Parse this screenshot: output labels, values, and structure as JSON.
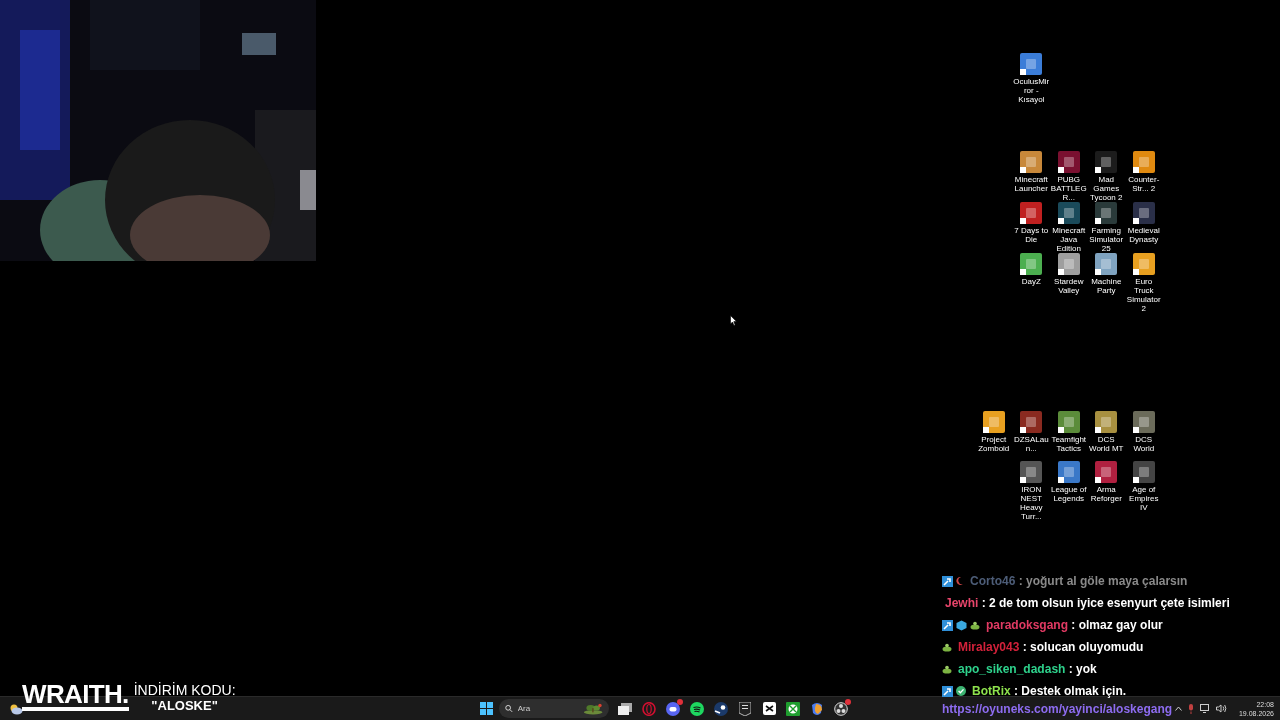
{
  "desktop_groups": [
    [
      [
        {
          "label": "OculusMirror - Kısayol"
        }
      ]
    ],
    [
      [
        {
          "label": "Minecraft Launcher"
        },
        {
          "label": "PUBG BATTLEGR..."
        },
        {
          "label": "Mad Games Tycoon 2"
        },
        {
          "label": "Counter-Str... 2"
        }
      ],
      [
        {
          "label": "7 Days to Die"
        },
        {
          "label": "Minecraft Java Edition"
        },
        {
          "label": "Farming Simulator 25"
        },
        {
          "label": "Medieval Dynasty"
        }
      ],
      [
        {
          "label": "DayZ"
        },
        {
          "label": "Stardew Valley"
        },
        {
          "label": "Machine Party"
        },
        {
          "label": "Euro Truck Simulator 2"
        }
      ]
    ],
    [
      [
        {
          "label": "Project Zomboid"
        },
        {
          "label": "DZSALaun..."
        },
        {
          "label": "Teamfight Tactics"
        },
        {
          "label": "DCS World MT"
        },
        {
          "label": "DCS World"
        }
      ],
      [
        {
          "label": "IRON NEST Heavy Turr..."
        },
        {
          "label": "League of Legends"
        },
        {
          "label": "Arma Reforger"
        },
        {
          "label": "Age of Empires IV"
        }
      ]
    ]
  ],
  "chat": [
    {
      "badges": [
        {
          "kind": "moderator"
        },
        {
          "kind": "moon"
        }
      ],
      "user": "Corto46",
      "color": "#4d5d78",
      "message": ": yoğurt al göle maya çalarsın",
      "faded": true
    },
    {
      "user": "Jewhi",
      "color": "#e8456b",
      "message": ": 2 de tom olsun iyice esenyurt çete isimleri",
      "faded": false
    },
    {
      "badges": [
        {
          "kind": "moderator"
        },
        {
          "kind": "cube"
        },
        {
          "kind": "sprout"
        }
      ],
      "user": "paradoksgang",
      "color": "#e23a63",
      "message": ": olmaz gay olur",
      "faded": false
    },
    {
      "badges": [
        {
          "kind": "sprout"
        }
      ],
      "user": "Miralay043",
      "color": "#d4213a",
      "message": ": solucan oluyomudu",
      "faded": false
    },
    {
      "badges": [
        {
          "kind": "sprout"
        }
      ],
      "user": "apo_siken_dadash",
      "color": "#2ed28c",
      "message": ": yok",
      "faded": false
    },
    {
      "badges": [
        {
          "kind": "moderator"
        },
        {
          "kind": "verified"
        }
      ],
      "user": "BotRix",
      "color": "#8ee24d",
      "message": ": Destek olmak için.",
      "faded": false
    }
  ],
  "chat_link": "https://oyuneks.com/yayinci/aloskegang",
  "promo": {
    "brand": "WRAITH.",
    "caption": "İNDİRİM KODU:",
    "code": "\"ALOSKE\""
  },
  "taskbar": {
    "search_placeholder": "Ara",
    "apps": [
      {
        "kind": "taskview",
        "badge": false
      },
      {
        "kind": "opera",
        "badge": false
      },
      {
        "kind": "discord",
        "badge": true
      },
      {
        "kind": "spotify",
        "badge": false
      },
      {
        "kind": "steam",
        "badge": false
      },
      {
        "kind": "epic",
        "badge": false
      },
      {
        "kind": "capcut",
        "badge": false
      },
      {
        "kind": "xbox",
        "badge": false
      },
      {
        "kind": "copilot",
        "badge": false
      },
      {
        "kind": "obs",
        "badge": true
      }
    ],
    "time": "22:08",
    "date": "19.08.2026"
  }
}
